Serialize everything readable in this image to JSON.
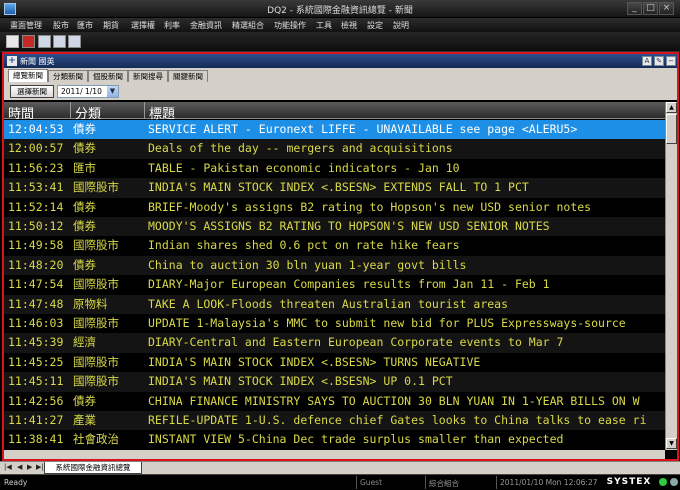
{
  "window": {
    "title": "DQ2 - 系統國際金融資訊總覽 - 新聞",
    "minimize": "_",
    "maximize": "□",
    "close": "×"
  },
  "menu": [
    "畫面管理",
    "股市",
    "匯市",
    "期貨",
    "選擇權",
    "利率",
    "金融資訊",
    "精選組合",
    "功能操作",
    "工具",
    "檢視",
    "設定",
    "說明"
  ],
  "panel": {
    "title": "新聞 國英",
    "pin_icon": "+"
  },
  "tabs": [
    "總覽新聞",
    "分類新聞",
    "個股新聞",
    "新聞搜尋",
    "關鍵新聞"
  ],
  "controls": {
    "select_news_button": "選擇新聞",
    "date_value": "2011/ 1/10"
  },
  "grid": {
    "columns": [
      "時間",
      "分類",
      "標題"
    ],
    "selected_index": 0,
    "rows": [
      {
        "time": "12:04:53",
        "category": "債券",
        "title": "SERVICE ALERT - Euronext LIFFE - UNAVAILABLE see page <ALERU5>"
      },
      {
        "time": "12:00:57",
        "category": "債券",
        "title": "Deals of the day -- mergers and acquisitions"
      },
      {
        "time": "11:56:23",
        "category": "匯市",
        "title": "TABLE - Pakistan economic indicators - Jan 10"
      },
      {
        "time": "11:53:41",
        "category": "國際股市",
        "title": "INDIA'S MAIN STOCK INDEX <.BSESN> EXTENDS FALL TO 1 PCT"
      },
      {
        "time": "11:52:14",
        "category": "債券",
        "title": "BRIEF-Moody's assigns B2 rating to Hopson's new USD senior notes"
      },
      {
        "time": "11:50:12",
        "category": "債券",
        "title": "MOODY'S ASSIGNS B2 RATING TO HOPSON'S NEW USD SENIOR NOTES"
      },
      {
        "time": "11:49:58",
        "category": "國際股市",
        "title": "Indian shares shed 0.6 pct on rate hike fears"
      },
      {
        "time": "11:48:20",
        "category": "債券",
        "title": "China to auction 30 bln yuan 1-year govt bills"
      },
      {
        "time": "11:47:54",
        "category": "國際股市",
        "title": "DIARY-Major European Companies results from Jan 11 - Feb 1"
      },
      {
        "time": "11:47:48",
        "category": "原物料",
        "title": "TAKE A LOOK-Floods threaten Australian tourist areas"
      },
      {
        "time": "11:46:03",
        "category": "國際股市",
        "title": "UPDATE 1-Malaysia's MMC to submit new bid for PLUS Expressways-source"
      },
      {
        "time": "11:45:39",
        "category": "經濟",
        "title": "DIARY-Central and Eastern European Corporate events to Mar 7"
      },
      {
        "time": "11:45:25",
        "category": "國際股市",
        "title": "INDIA'S MAIN STOCK INDEX <.BSESN> TURNS NEGATIVE"
      },
      {
        "time": "11:45:11",
        "category": "國際股市",
        "title": "INDIA'S MAIN STOCK INDEX <.BSESN> UP 0.1 PCT"
      },
      {
        "time": "11:42:56",
        "category": "債券",
        "title": "CHINA FINANCE MINISTRY SAYS TO AUCTION 30  BLN YUAN IN 1-YEAR BILLS ON W"
      },
      {
        "time": "11:41:27",
        "category": "產業",
        "title": "REFILE-UPDATE 1-U.S. defence chief Gates looks to China talks to ease ri"
      },
      {
        "time": "11:38:41",
        "category": "社會政治",
        "title": "INSTANT VIEW 5-China Dec trade surplus smaller than expected"
      }
    ]
  },
  "sheet_tab": "系統國際金融資訊總覽",
  "status": {
    "ready": "Ready",
    "user": "Guest",
    "combo": "綜合組合",
    "datetime": "2011/01/10 Mon 12:06:27",
    "brand": "SYSTEX"
  },
  "colors": {
    "selected_row": "#1e8fe6",
    "row_text": "#d9d948",
    "panel_border": "#d9141a"
  }
}
